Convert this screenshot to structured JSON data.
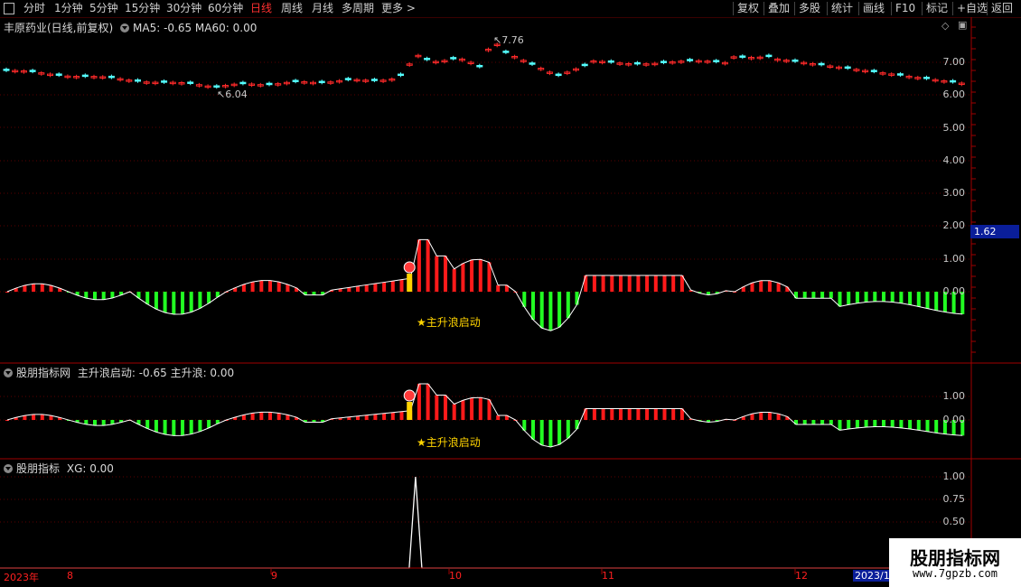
{
  "toolbar": {
    "periods": [
      "分时",
      "1分钟",
      "5分钟",
      "15分钟",
      "30分钟",
      "60分钟",
      "日线",
      "周线",
      "月线",
      "多周期",
      "更多 >"
    ],
    "active_period": "日线",
    "right_buttons": [
      "复权",
      "叠加",
      "多股",
      "统计",
      "画线",
      "F10",
      "标记",
      "+自选",
      "返回"
    ]
  },
  "main_panel": {
    "stock_name": "丰原药业(日线,前复权)",
    "indicators": "MA5: -0.65  MA60: 0.00",
    "high_label": "7.76",
    "low_label": "6.04",
    "y_ticks": [
      "7.00",
      "6.00",
      "5.00",
      "4.00",
      "3.00",
      "2.00",
      "1.00",
      "0.00"
    ],
    "current_value": "1.62",
    "signal_text": "★主升浪启动"
  },
  "panel2": {
    "title": "股朋指标网",
    "values": "主升浪启动: -0.65  主升浪: 0.00",
    "y_ticks": [
      "1.00",
      "0.00"
    ],
    "signal_text": "★主升浪启动"
  },
  "panel3": {
    "title": "股朋指标",
    "values": "XG: 0.00",
    "y_ticks": [
      "1.00",
      "0.75",
      "0.50"
    ]
  },
  "time_axis": {
    "year": "2023年",
    "months": [
      "8",
      "9",
      "10",
      "11",
      "12"
    ],
    "current": "2023/1"
  },
  "watermark": {
    "title": "股朋指标网",
    "url": "www.7gpzb.com"
  },
  "colors": {
    "up": "#ff2a2a",
    "down": "#54ffff",
    "pos_bar": "#ff1a1a",
    "neg_bar": "#22ff22",
    "signal": "#ffd400",
    "grid": "#5a0000"
  }
}
